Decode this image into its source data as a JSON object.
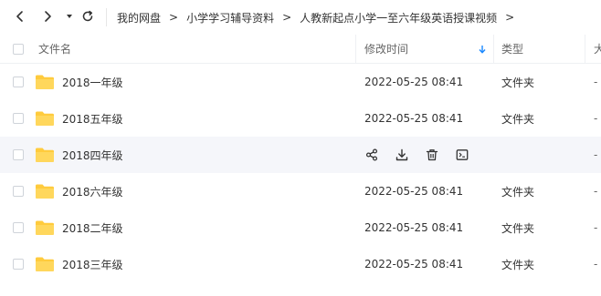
{
  "breadcrumb": {
    "items": [
      "我的网盘",
      "小学学习辅导资料",
      "人教新起点小学一至六年级英语授课视频"
    ],
    "separator": ">"
  },
  "columns": {
    "name": "文件名",
    "modified": "修改时间",
    "type": "类型",
    "size": "大"
  },
  "rows": [
    {
      "name": "2018一年级",
      "modified": "2022-05-25 08:41",
      "type": "文件夹",
      "size": "-"
    },
    {
      "name": "2018五年级",
      "modified": "2022-05-25 08:41",
      "type": "文件夹",
      "size": "-"
    },
    {
      "name": "2018四年级",
      "modified": "",
      "type": "",
      "size": "-"
    },
    {
      "name": "2018六年级",
      "modified": "2022-05-25 08:41",
      "type": "文件夹",
      "size": "-"
    },
    {
      "name": "2018二年级",
      "modified": "2022-05-25 08:41",
      "type": "文件夹",
      "size": "-"
    },
    {
      "name": "2018三年级",
      "modified": "2022-05-25 08:41",
      "type": "文件夹",
      "size": "-"
    }
  ],
  "colors": {
    "folder": "#FFCB3D",
    "sort_arrow": "#1a88ff",
    "hover_row": "#f5f6fa"
  }
}
